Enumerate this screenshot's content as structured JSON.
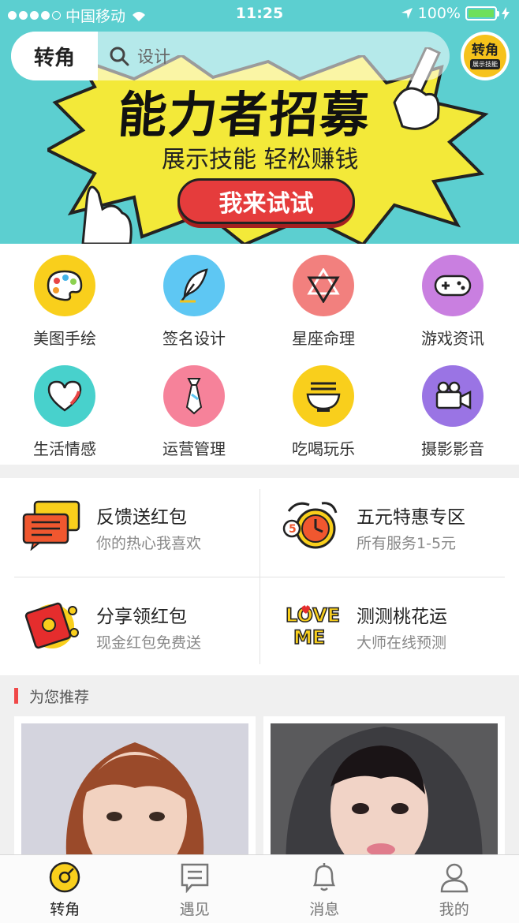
{
  "status_bar": {
    "carrier": "中国移动",
    "time": "11:25",
    "battery": "100%"
  },
  "header": {
    "brand": "转角",
    "search_placeholder": "设计",
    "badge_title": "转角",
    "badge_sub": "展示技能"
  },
  "banner": {
    "title": "能力者招募",
    "subtitle": "展示技能 轻松赚钱",
    "button": "我来试试"
  },
  "categories": [
    {
      "label": "美图手绘",
      "icon": "palette-icon",
      "color": "#f9cf1c"
    },
    {
      "label": "签名设计",
      "icon": "feather-pen-icon",
      "color": "#5ec7f3"
    },
    {
      "label": "星座命理",
      "icon": "star-of-david-icon",
      "color": "#f2807e"
    },
    {
      "label": "游戏资讯",
      "icon": "gamepad-icon",
      "color": "#c97fe0"
    },
    {
      "label": "生活情感",
      "icon": "heart-icon",
      "color": "#48d1cc"
    },
    {
      "label": "运营管理",
      "icon": "necktie-icon",
      "color": "#f6829a"
    },
    {
      "label": "吃喝玩乐",
      "icon": "noodle-bowl-icon",
      "color": "#f9cf1c"
    },
    {
      "label": "摄影影音",
      "icon": "video-camera-icon",
      "color": "#9a74e4"
    }
  ],
  "promos": [
    {
      "title": "反馈送红包",
      "subtitle": "你的热心我喜欢",
      "icon": "chat-bubbles-icon"
    },
    {
      "title": "五元特惠专区",
      "subtitle": "所有服务1-5元",
      "icon": "alarm-clock-icon"
    },
    {
      "title": "分享领红包",
      "subtitle": "现金红包免费送",
      "icon": "red-envelope-icon"
    },
    {
      "title": "测测桃花运",
      "subtitle": "大师在线预测",
      "icon": "love-me-icon"
    }
  ],
  "recommend": {
    "title": "为您推荐"
  },
  "tabs": [
    {
      "label": "转角",
      "icon": "compass-icon",
      "active": true
    },
    {
      "label": "遇见",
      "icon": "message-board-icon",
      "active": false
    },
    {
      "label": "消息",
      "icon": "bell-icon",
      "active": false
    },
    {
      "label": "我的",
      "icon": "user-icon",
      "active": false
    }
  ],
  "colors": {
    "accent": "#f9cf1c",
    "banner_bg": "#5ccfd0",
    "banner_button": "#e53c3c"
  }
}
